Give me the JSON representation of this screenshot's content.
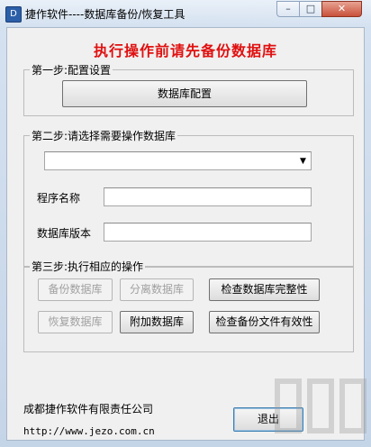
{
  "window": {
    "title": "捷作软件----数据库备份/恢复工具",
    "icon": "app-database-icon",
    "minimize_glyph": "–",
    "maximize_glyph": "□",
    "close_glyph": "✕"
  },
  "headline": "执行操作前请先备份数据库",
  "step1": {
    "label": "第一步:配置设置",
    "config_button": "数据库配置"
  },
  "step2": {
    "label": "第二步:请选择需要操作数据库",
    "database_select_value": "",
    "program_name_label": "程序名称",
    "program_name_value": "",
    "db_version_label": "数据库版本",
    "db_version_value": ""
  },
  "step3": {
    "label": "第三步:执行相应的操作",
    "backup_button": "备份数据库",
    "detach_button": "分离数据库",
    "check_integrity_button": "检查数据库完整性",
    "restore_button": "恢复数据库",
    "attach_button": "附加数据库",
    "check_backup_button": "检查备份文件有效性"
  },
  "footer": {
    "company": "成都捷作软件有限责任公司",
    "url": "http://www.jezo.com.cn",
    "exit_button": "退出"
  },
  "colors": {
    "headline": "#e01010",
    "titlebar": "#d4e1f0",
    "background": "#f0f0f0"
  }
}
